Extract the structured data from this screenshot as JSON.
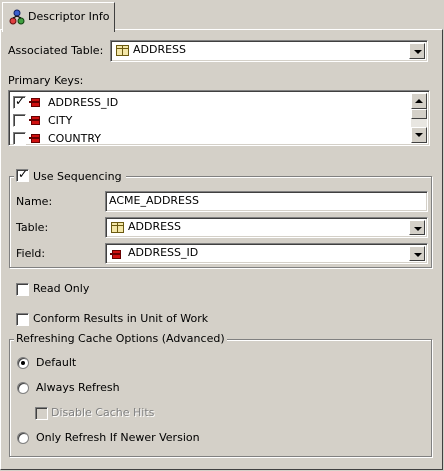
{
  "tab": {
    "label": "Descriptor Info",
    "icon": "descriptor-icon"
  },
  "associated_table": {
    "label": "Associated Table:",
    "value": "ADDRESS",
    "icon": "table-icon"
  },
  "primary_keys": {
    "label": "Primary Keys:",
    "items": [
      {
        "label": "ADDRESS_ID",
        "checked": true,
        "icon": "field-key-icon"
      },
      {
        "label": "CITY",
        "checked": false,
        "icon": "field-key-icon"
      },
      {
        "label": "COUNTRY",
        "checked": false,
        "icon": "field-key-icon"
      }
    ]
  },
  "sequencing": {
    "label": "Use Sequencing",
    "checked": true,
    "name_label": "Name:",
    "name_value": "ACME_ADDRESS",
    "table_label": "Table:",
    "table_value": "ADDRESS",
    "field_label": "Field:",
    "field_value": "ADDRESS_ID"
  },
  "read_only": {
    "label": "Read Only",
    "checked": false
  },
  "conform_results": {
    "label": "Conform Results in Unit of Work",
    "checked": false
  },
  "refresh_cache": {
    "title": "Refreshing Cache Options (Advanced)",
    "options": [
      {
        "label": "Default",
        "selected": true
      },
      {
        "label": "Always Refresh",
        "selected": false
      },
      {
        "label": "Only Refresh If Newer Version",
        "selected": false
      }
    ],
    "disable_cache_hits": {
      "label": "Disable Cache Hits",
      "checked": false,
      "enabled": false
    }
  },
  "colors": {
    "face": "#d4d0c8",
    "shadow": "#808080",
    "highlight": "#ffffff",
    "disabled_text": "#808080"
  }
}
